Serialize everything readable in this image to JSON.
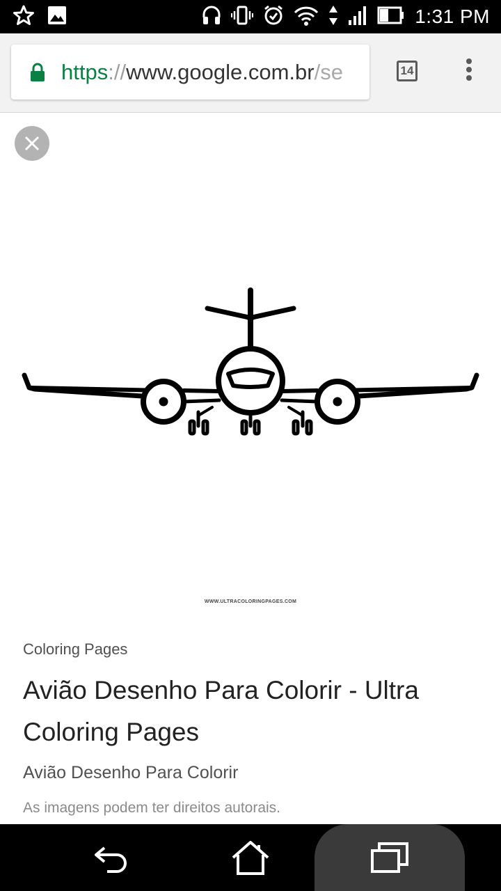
{
  "status_bar": {
    "time": "1:31 PM",
    "left_icons": [
      "star-icon",
      "image-notification-icon"
    ],
    "right_icons": [
      "headset-icon",
      "vibrate-icon",
      "alarm-icon",
      "wifi-icon",
      "data-arrows-icon",
      "signal-icon",
      "battery-icon"
    ]
  },
  "browser": {
    "url_scheme": "https",
    "url_separator": "://",
    "url_host": "www.google.com.br",
    "url_path": "/se",
    "tab_count": "14",
    "accent_secure_color": "#0b8043"
  },
  "viewer": {
    "watermark": "WWW.ULTRACOLORINGPAGES.COM",
    "source": "Coloring Pages",
    "title": "Avião Desenho Para Colorir - Ultra Coloring Pages",
    "subtitle": "Avião Desenho Para Colorir",
    "copyright_notice": "As imagens podem ter direitos autorais."
  },
  "nav_bar": {
    "icons": [
      "back-icon",
      "home-icon",
      "recents-icon"
    ]
  }
}
